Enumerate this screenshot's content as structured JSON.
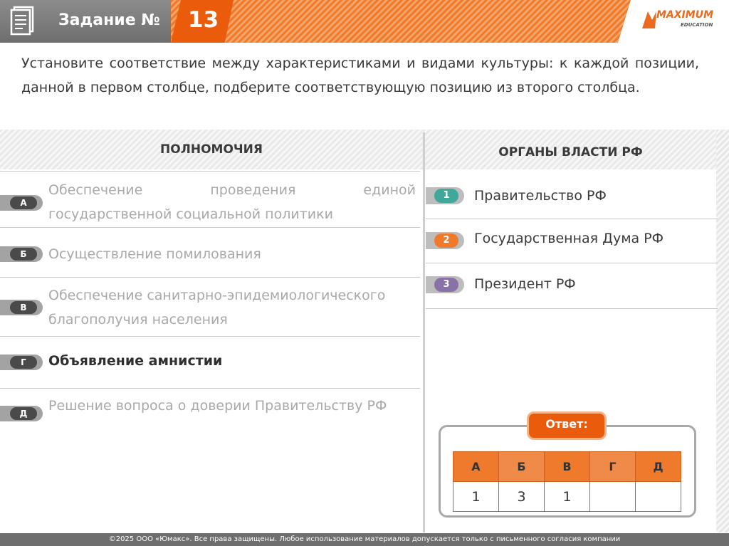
{
  "header": {
    "task_label": "Задание №",
    "task_number": "13",
    "logo_main": "MAXIMUM",
    "logo_sub": "EDUCATION",
    "accent_color": "#ea5b0c"
  },
  "question": "Установите соответствие между характеристиками и видами культуры: к каждой позиции, данной в первом столбце, подберите соответствующую позицию из второго столбца.",
  "left_column": {
    "title": "ПОЛНОМОЧИЯ",
    "items": [
      {
        "letter": "А",
        "text": "Обеспечение проведения единой государственной социальной политики"
      },
      {
        "letter": "Б",
        "text": "Осуществление помилования"
      },
      {
        "letter": "В",
        "text": "Обеспечение санитарно-эпидемиологического благополучия населения"
      },
      {
        "letter": "Г",
        "text": "Объявление амнистии"
      },
      {
        "letter": "Д",
        "text": "Решение вопроса о доверии Правительству РФ"
      }
    ]
  },
  "right_column": {
    "title": "ОРГАНЫ ВЛАСТИ РФ",
    "items": [
      {
        "number": "1",
        "text": "Правительство РФ",
        "color": "#3fa89a"
      },
      {
        "number": "2",
        "text": "Государственная Дума РФ",
        "color": "#ef7a2c"
      },
      {
        "number": "3",
        "text": "Президент РФ",
        "color": "#8a72a8"
      }
    ]
  },
  "answer": {
    "label": "Ответ:",
    "headers": [
      "А",
      "Б",
      "В",
      "Г",
      "Д"
    ],
    "values": [
      "1",
      "3",
      "1",
      "",
      ""
    ]
  },
  "footer": "©2025 ООО «Юмакс». Все права защищены. Любое использование материалов допускается только с письменного согласия компании"
}
